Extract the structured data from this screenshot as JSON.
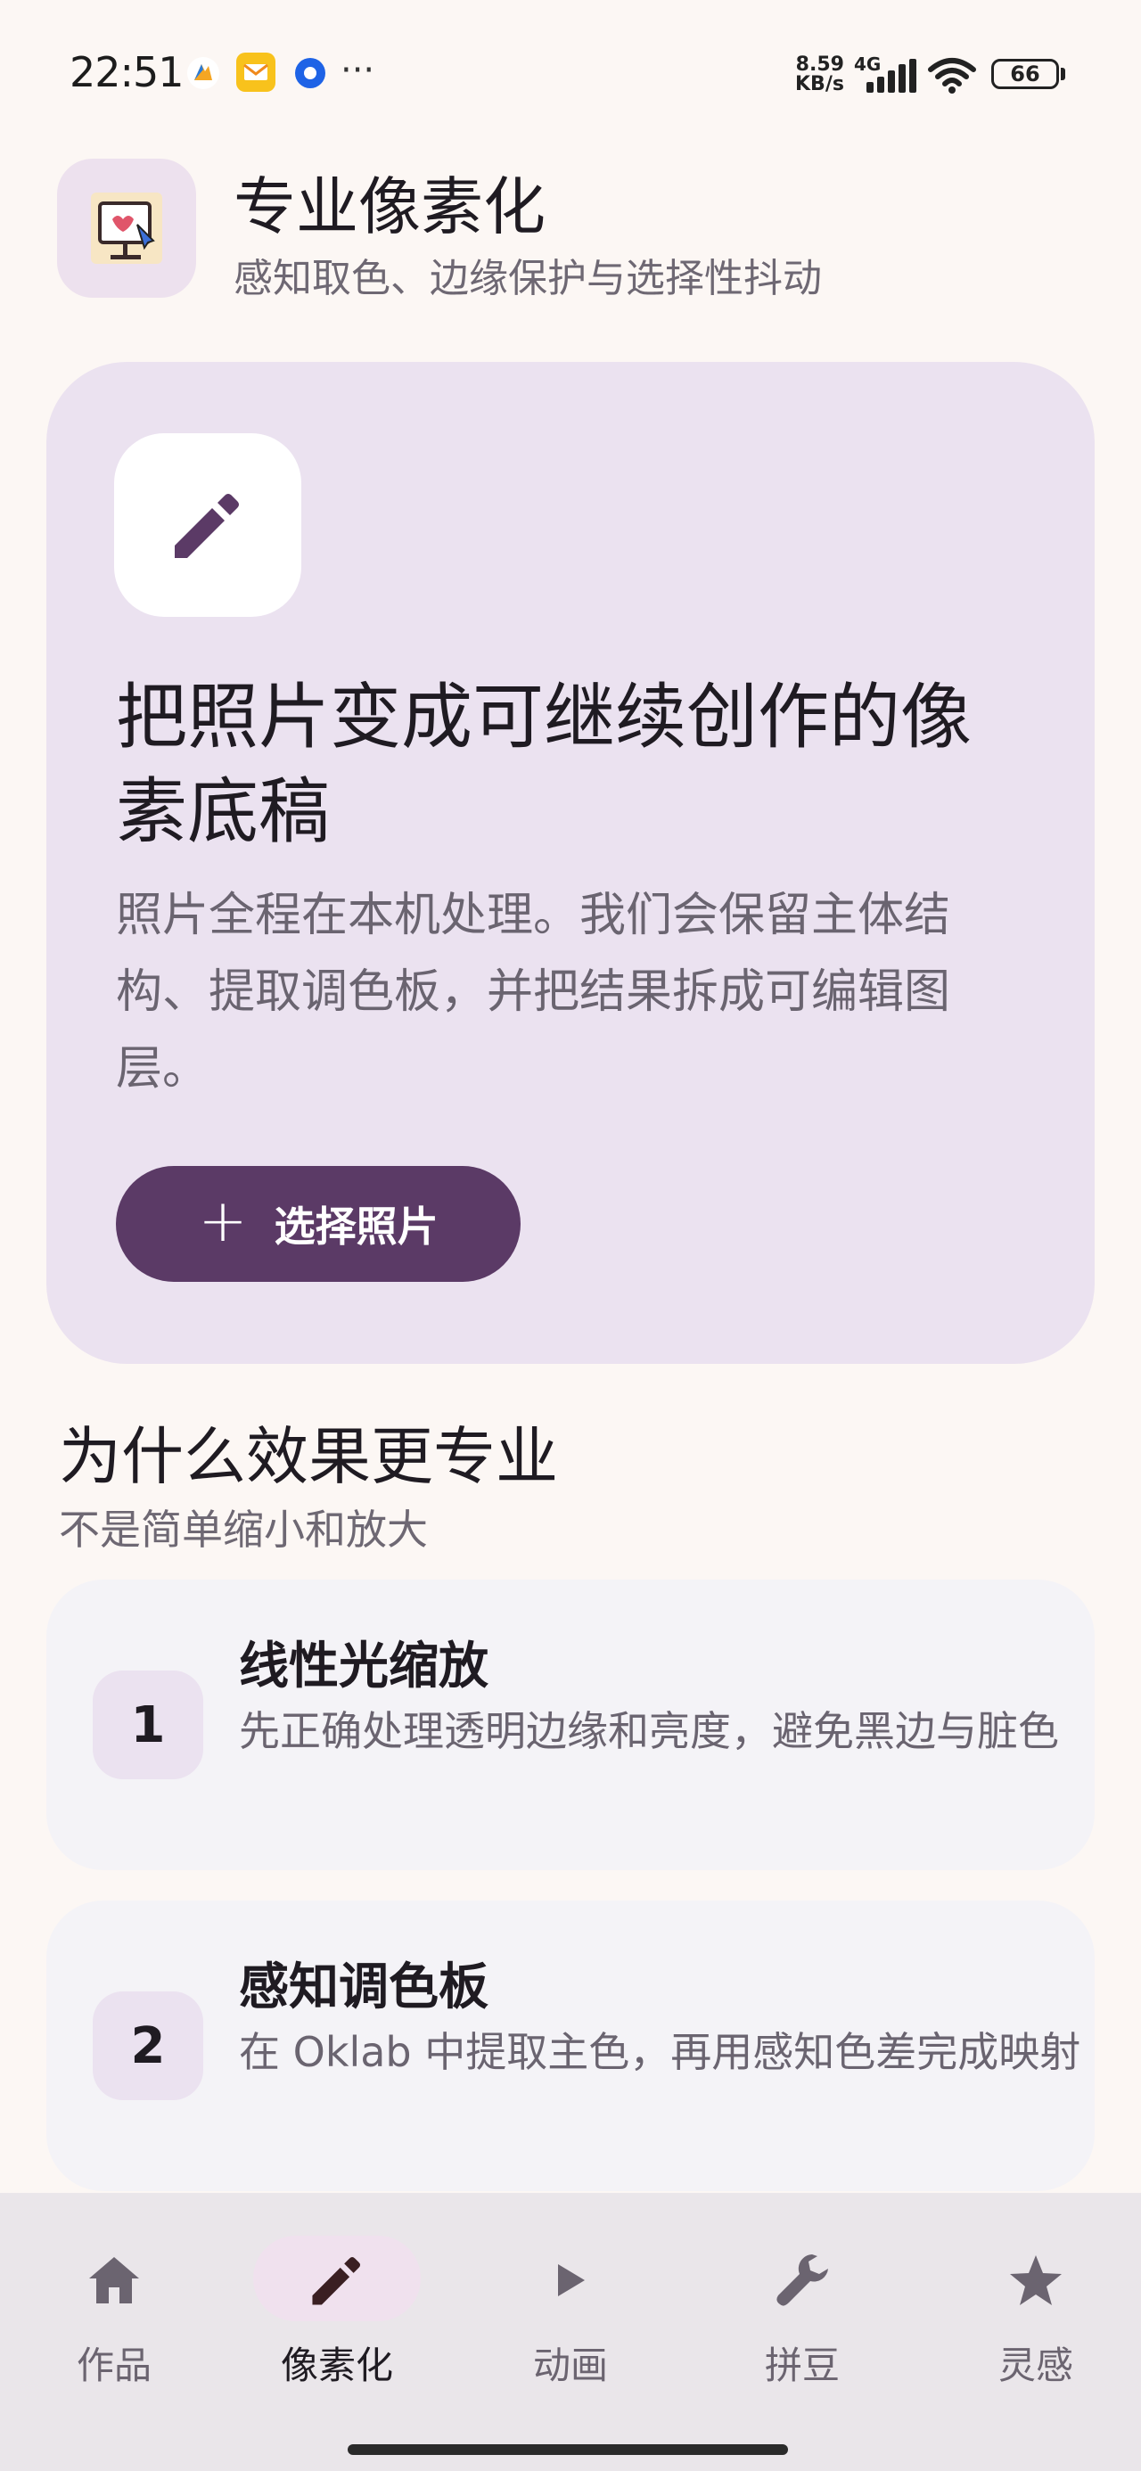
{
  "status_bar": {
    "time": "22:51",
    "net_speed_value": "8.59",
    "net_speed_unit": "KB/s",
    "network_type": "4G",
    "battery": "66",
    "icons": [
      "notification-app-icon",
      "mail-icon",
      "location-app-icon",
      "more-dots-icon",
      "signal-icon",
      "wifi-icon",
      "battery-icon"
    ],
    "more": "···"
  },
  "header": {
    "title": "专业像素化",
    "subtitle": "感知取色、边缘保护与选择性抖动",
    "logo_icon": "pixel-easel-logo"
  },
  "hero": {
    "icon": "pencil-icon",
    "title": "把照片变成可继续创作的像素底稿",
    "description": "照片全程在本机处理。我们会保留主体结构、提取调色板，并把结果拆成可编辑图层。",
    "button_icon": "+",
    "button_label": "选择照片"
  },
  "why": {
    "title": "为什么效果更专业",
    "subtitle": "不是简单缩小和放大",
    "items": [
      {
        "number": "1",
        "title": "线性光缩放",
        "description": "先正确处理透明边缘和亮度，避免黑边与脏色"
      },
      {
        "number": "2",
        "title": "感知调色板",
        "description": "在 Oklab 中提取主色，再用感知色差完成映射"
      }
    ]
  },
  "nav": {
    "items": [
      {
        "label": "作品",
        "icon": "home-icon",
        "active": false
      },
      {
        "label": "像素化",
        "icon": "pencil-icon",
        "active": true
      },
      {
        "label": "动画",
        "icon": "play-icon",
        "active": false
      },
      {
        "label": "拼豆",
        "icon": "wrench-icon",
        "active": false
      },
      {
        "label": "灵感",
        "icon": "star-icon",
        "active": false
      }
    ]
  },
  "colors": {
    "background": "#fcf7f4",
    "hero_card": "#ebe2f0",
    "primary": "#5b3a66",
    "feature_card": "#f4f3f7",
    "nav_bar": "#eae6ea",
    "active_pill": "#f0e1ee"
  }
}
